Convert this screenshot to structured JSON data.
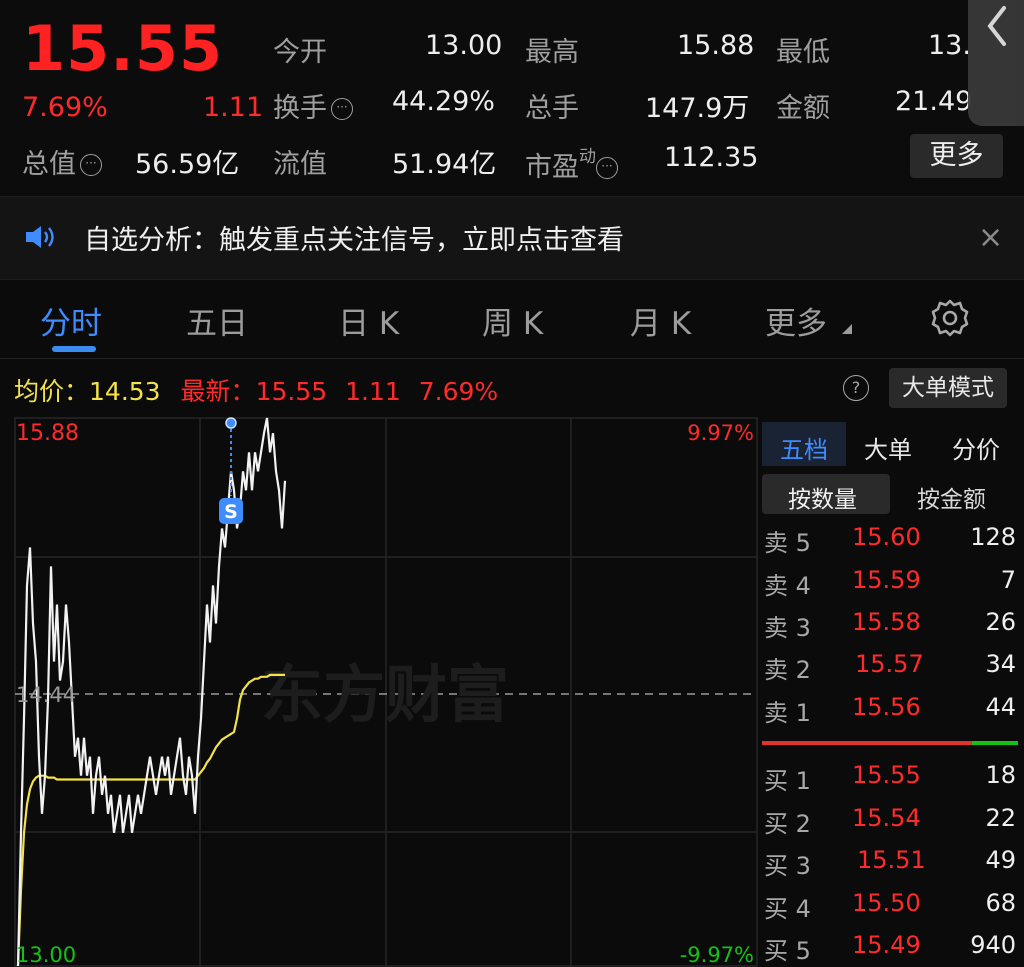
{
  "quote": {
    "price": "15.55",
    "change_pct": "7.69%",
    "change": "1.11",
    "rows": [
      {
        "label": "今开",
        "value": "13.00"
      },
      {
        "label": "最高",
        "value": "15.88"
      },
      {
        "label": "最低",
        "value": "13."
      },
      {
        "label": "换手",
        "value": "44.29%"
      },
      {
        "label": "总手",
        "value": "147.9万"
      },
      {
        "label": "金额",
        "value": "21.49"
      },
      {
        "label": "总值",
        "value": "56.59亿"
      },
      {
        "label": "流值",
        "value": "51.94亿"
      },
      {
        "label": "市盈",
        "label_sup": "动",
        "value": "112.35"
      }
    ],
    "more_label": "更多",
    "info_icon_glyph": "···"
  },
  "notice": {
    "text": "自选分析：触发重点关注信号，立即点击查看",
    "close_glyph": "×"
  },
  "tabs": [
    {
      "label": "分时",
      "active": true
    },
    {
      "label": "五日",
      "active": false
    },
    {
      "label": "日 K",
      "active": false
    },
    {
      "label": "周 K",
      "active": false
    },
    {
      "label": "月 K",
      "active": false
    },
    {
      "label": "更多",
      "active": false
    }
  ],
  "statline": {
    "avg_label": "均价：",
    "avg_value": "14.53",
    "latest_label": "最新：",
    "latest_value": "15.55",
    "latest_change": "1.11",
    "latest_pct": "7.69%",
    "help_glyph": "?",
    "big_order_mode": "大单模式"
  },
  "chart": {
    "top_price": "15.88",
    "mid_price": "14.44",
    "bottom_price": "13.00",
    "top_pct": "9.97%",
    "bottom_pct": "-9.97%",
    "watermark": "东方财富",
    "marker_letter": "S"
  },
  "chart_data": {
    "type": "line",
    "ylim": [
      13.0,
      15.88
    ],
    "reference_price": 14.44,
    "series": [
      {
        "name": "最新",
        "values": [
          13.0,
          13.7,
          14.3,
          15.0,
          15.2,
          14.8,
          14.6,
          14.1,
          13.8,
          14.0,
          14.4,
          15.1,
          14.6,
          14.9,
          14.5,
          14.6,
          14.9,
          14.7,
          14.4,
          14.1,
          14.2,
          14.0,
          14.2,
          14.0,
          14.1,
          13.8,
          14.0,
          14.1,
          13.9,
          14.0,
          13.8,
          13.9,
          13.7,
          13.8,
          13.9,
          13.7,
          13.8,
          13.9,
          13.7,
          13.8,
          13.9,
          13.8,
          13.9,
          14.0,
          14.1,
          14.0,
          13.9,
          14.0,
          14.1,
          14.0,
          14.1,
          13.9,
          14.0,
          14.1,
          14.2,
          14.0,
          13.9,
          14.1,
          14.0,
          13.8,
          14.1,
          14.3,
          14.6,
          14.9,
          14.7,
          15.0,
          14.8,
          15.1,
          15.3,
          15.2,
          15.4,
          15.6,
          15.5,
          15.3,
          15.4,
          15.6,
          15.5,
          15.7,
          15.5,
          15.7,
          15.6,
          15.7,
          15.8,
          15.88,
          15.7,
          15.8,
          15.6,
          15.5,
          15.3,
          15.55
        ]
      },
      {
        "name": "均价",
        "values": [
          13.0,
          13.4,
          13.7,
          13.85,
          13.93,
          13.97,
          13.99,
          14.0,
          14.0,
          14.0,
          13.99,
          13.99,
          13.99,
          13.98,
          13.98,
          13.98,
          13.98,
          13.98,
          13.98,
          13.98,
          13.98,
          13.98,
          13.98,
          13.98,
          13.98,
          13.98,
          13.98,
          13.98,
          13.98,
          13.98,
          13.98,
          13.98,
          13.98,
          13.98,
          13.98,
          13.98,
          13.98,
          13.98,
          13.98,
          13.98,
          13.98,
          13.98,
          13.98,
          13.98,
          13.98,
          13.98,
          13.98,
          13.98,
          13.98,
          13.98,
          13.98,
          13.98,
          13.98,
          13.98,
          13.98,
          13.98,
          13.98,
          13.98,
          13.98,
          13.98,
          14.0,
          14.02,
          14.04,
          14.07,
          14.09,
          14.12,
          14.15,
          14.17,
          14.19,
          14.2,
          14.21,
          14.22,
          14.23,
          14.3,
          14.4,
          14.45,
          14.47,
          14.49,
          14.5,
          14.51,
          14.51,
          14.52,
          14.52,
          14.52,
          14.53,
          14.53,
          14.53,
          14.53,
          14.53,
          14.53
        ]
      }
    ]
  },
  "book": {
    "tabs": [
      "五档",
      "大单",
      "分价"
    ],
    "segments": [
      "按数量",
      "按金额"
    ],
    "asks": [
      {
        "label": "卖 5",
        "price": "15.60",
        "vol": "128"
      },
      {
        "label": "卖 4",
        "price": "15.59",
        "vol": "7"
      },
      {
        "label": "卖 3",
        "price": "15.58",
        "vol": "26"
      },
      {
        "label": "卖 2",
        "price": "15.57",
        "vol": "34"
      },
      {
        "label": "卖 1",
        "price": "15.56",
        "vol": "44"
      }
    ],
    "bids": [
      {
        "label": "买 1",
        "price": "15.55",
        "vol": "18"
      },
      {
        "label": "买 2",
        "price": "15.54",
        "vol": "22"
      },
      {
        "label": "买 3",
        "price": "15.51",
        "vol": "49"
      },
      {
        "label": "买 4",
        "price": "15.50",
        "vol": "68"
      },
      {
        "label": "买 5",
        "price": "15.49",
        "vol": "940"
      }
    ],
    "buy_ratio": 0.82,
    "colors": {
      "up": "#ff2a2a",
      "down": "#14c214"
    }
  }
}
